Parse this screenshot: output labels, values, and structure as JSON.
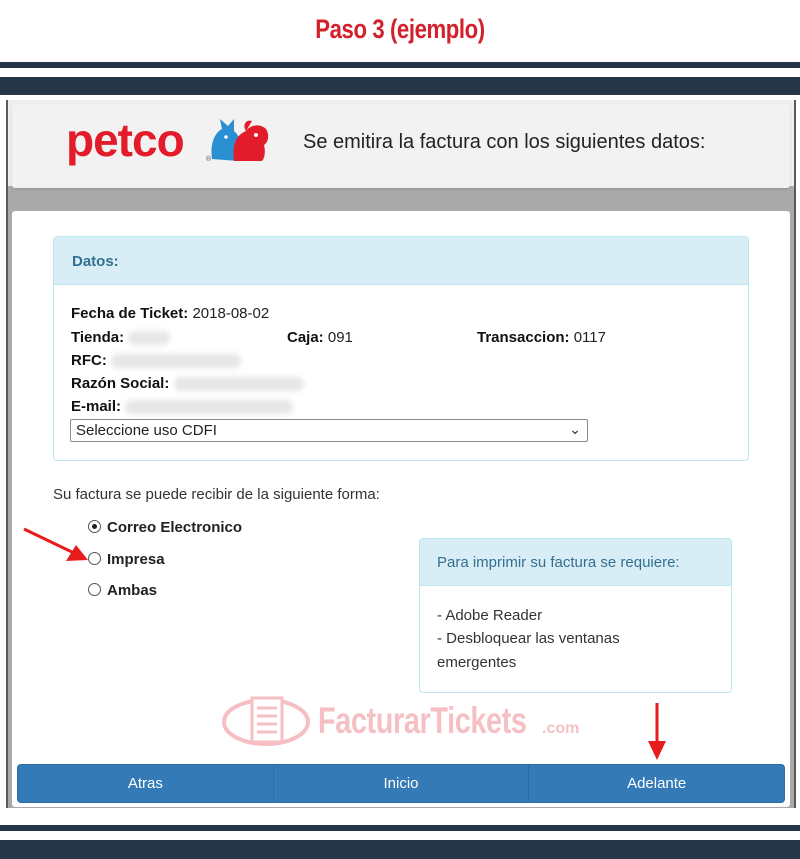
{
  "page_title": "Paso 3 (ejemplo)",
  "brand": {
    "logo_text": "petco",
    "logo_icon": "petco-dog-cat-icon"
  },
  "header_message": "Se emitira la factura con los siguientes datos:",
  "datos": {
    "title": "Datos:",
    "fecha_label": "Fecha de Ticket:",
    "fecha_value": "2018-08-02",
    "tienda_label": "Tienda:",
    "caja_label": "Caja:",
    "caja_value": "091",
    "transaccion_label": "Transaccion:",
    "transaccion_value": "0117",
    "rfc_label": "RFC:",
    "razon_label": "Razón Social:",
    "email_label": "E-mail:"
  },
  "cfdi_select": {
    "selected": "Seleccione uso CDFI"
  },
  "recibir_text": "Su factura se puede recibir de la siguiente forma:",
  "delivery_options": [
    {
      "label": "Correo Electronico",
      "checked": true
    },
    {
      "label": "Impresa",
      "checked": false
    },
    {
      "label": "Ambas",
      "checked": false
    }
  ],
  "print_panel": {
    "title": "Para imprimir su factura se requiere:",
    "items": [
      "- Adobe Reader",
      "- Desbloquear las ventanas",
      "emergentes"
    ]
  },
  "watermark": {
    "text": "FacturarTickets",
    "suffix": ".com"
  },
  "buttons": {
    "atras": "Atras",
    "inicio": "Inicio",
    "adelante": "Adelante"
  },
  "colors": {
    "brand_red": "#e21c2a",
    "nav_dark": "#253649",
    "button_blue": "#337ab7",
    "panel_head": "#d9edf7"
  }
}
